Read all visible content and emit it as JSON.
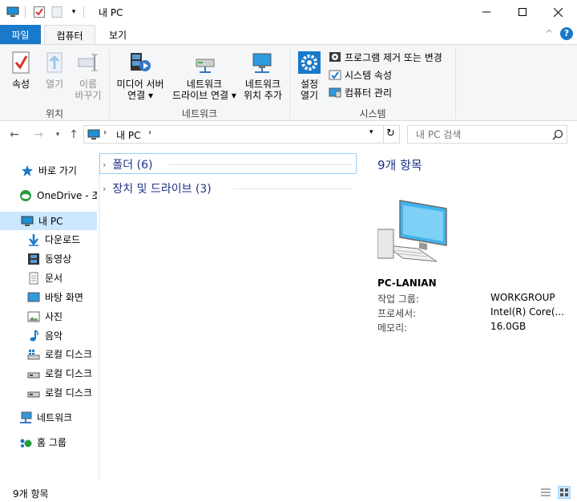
{
  "window": {
    "title": "내 PC",
    "minimize_icon": "minimize-icon",
    "maximize_icon": "maximize-icon",
    "close_icon": "close-icon"
  },
  "tabs": {
    "file": "파일",
    "computer": "컴퓨터",
    "view": "보기"
  },
  "ribbon": {
    "location": {
      "label": "위치",
      "properties": "속성",
      "open": "열기",
      "rename_line1": "이름",
      "rename_line2": "바꾸기"
    },
    "network": {
      "label": "네트워크",
      "media_line1": "미디어 서버",
      "media_line2": "연결",
      "map_line1": "네트워크",
      "map_line2": "드라이브 연결",
      "add_line1": "네트워크",
      "add_line2": "위치 추가"
    },
    "system": {
      "label": "시스템",
      "settings_line1": "설정",
      "settings_line2": "열기",
      "uninstall": "프로그램 제거 또는 변경",
      "sys_props": "시스템 속성",
      "manage": "컴퓨터 관리"
    }
  },
  "address": {
    "path": "내 PC",
    "search_placeholder": "내 PC 검색"
  },
  "nav": {
    "quick_access": "바로 가기",
    "onedrive": "OneDrive - 조",
    "this_pc": "내 PC",
    "downloads": "다운로드",
    "videos": "동영상",
    "documents": "문서",
    "desktop": "바탕 화면",
    "pictures": "사진",
    "music": "음악",
    "disk1": "로컬 디스크",
    "disk2": "로컬 디스크",
    "disk3": "로컬 디스크",
    "network": "네트워크",
    "homegroup": "홈 그룹"
  },
  "content": {
    "folders": "폴더 (6)",
    "devices": "장치 및 드라이브 (3)"
  },
  "details": {
    "count": "9개 항목",
    "pc_name": "PC-LANIAN",
    "workgroup_label": "작업 그룹:",
    "workgroup_value": "WORKGROUP",
    "cpu_label": "프로세서:",
    "cpu_value": "Intel(R) Core(...",
    "mem_label": "메모리:",
    "mem_value": "16.0GB"
  },
  "status": {
    "count": "9개 항목"
  }
}
